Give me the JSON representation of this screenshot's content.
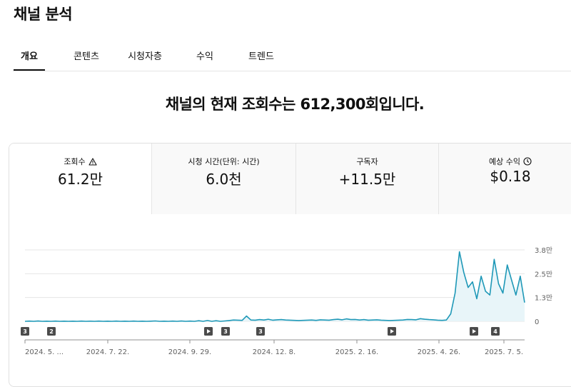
{
  "page": {
    "title": "채널 분석"
  },
  "tabs": [
    {
      "label": "개요",
      "active": true
    },
    {
      "label": "콘텐츠",
      "active": false
    },
    {
      "label": "시청자층",
      "active": false
    },
    {
      "label": "수익",
      "active": false
    },
    {
      "label": "트렌드",
      "active": false
    }
  ],
  "headline": "채널의 현재 조회수는 612,300회입니다.",
  "metrics": [
    {
      "label": "조회수",
      "value": "61.2만",
      "icon": "warning-icon",
      "active": true
    },
    {
      "label": "시청 시간(단위: 시간)",
      "value": "6.0천",
      "icon": "",
      "active": false
    },
    {
      "label": "구독자",
      "value": "+11.5만",
      "icon": "",
      "active": false
    },
    {
      "label": "예상 수익",
      "value": "$0.18",
      "icon": "clock-icon",
      "active": false
    }
  ],
  "colors": {
    "line": "#1e98b7",
    "fill": "#e8f5f9",
    "marker": "#4b4b4b",
    "grid": "#e5e5e5"
  },
  "chart_data": {
    "type": "line",
    "x_tick_labels": [
      "2024. 5. ...",
      "2024. 7. 22.",
      "2024. 9. 29.",
      "2024. 12. 8.",
      "2025. 2. 16.",
      "2025. 4. 26.",
      "2025. 7. 5."
    ],
    "y_tick_labels": [
      "3.8만",
      "2.5만",
      "1.3만",
      "0"
    ],
    "ylim": [
      0,
      38000
    ],
    "series": [
      {
        "values": [
          0,
          100,
          0,
          150,
          0,
          80,
          0,
          100,
          0,
          60,
          0,
          80,
          0,
          120,
          0,
          90,
          0,
          100,
          0,
          80,
          0,
          100,
          0,
          90,
          0,
          110,
          0,
          80,
          0,
          70,
          200,
          0,
          90,
          0,
          100,
          0,
          150,
          0,
          100,
          0,
          300,
          0,
          400,
          0,
          300,
          0,
          200,
          400,
          700,
          600,
          500,
          2800,
          700,
          600,
          900,
          700,
          1100,
          600,
          800,
          900,
          700,
          600,
          500,
          400,
          500,
          600,
          700,
          500,
          800,
          700,
          600,
          900,
          1100,
          800,
          1300,
          900,
          1000,
          700,
          900,
          600,
          700,
          800,
          600,
          500,
          400,
          500,
          600,
          700,
          1000,
          900,
          800,
          1400,
          1100,
          900,
          800,
          600,
          500,
          700,
          4000,
          15000,
          37000,
          26000,
          18000,
          21000,
          12000,
          24000,
          16000,
          14000,
          33000,
          20000,
          15000,
          30000,
          22000,
          14000,
          24000,
          10000
        ]
      }
    ],
    "event_markers": [
      {
        "label": "3",
        "kind": "number"
      },
      {
        "label": "2",
        "kind": "number"
      },
      {
        "label": "",
        "kind": "play"
      },
      {
        "label": "3",
        "kind": "number"
      },
      {
        "label": "3",
        "kind": "number"
      },
      {
        "label": "",
        "kind": "play"
      },
      {
        "label": "",
        "kind": "play"
      },
      {
        "label": "4",
        "kind": "number"
      }
    ]
  }
}
